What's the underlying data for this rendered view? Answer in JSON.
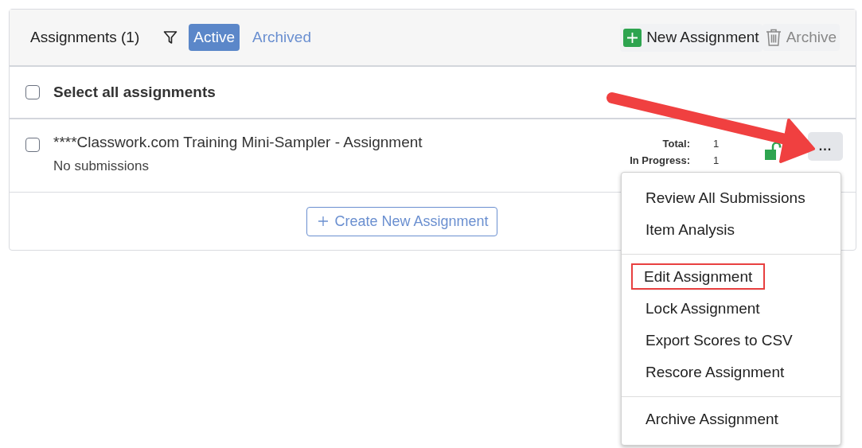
{
  "header": {
    "title": "Assignments (1)",
    "tabs": [
      {
        "label": "Active",
        "selected": true
      },
      {
        "label": "Archived",
        "selected": false
      }
    ],
    "actions": [
      {
        "kind": "new",
        "label": "New Assignment"
      },
      {
        "kind": "archive",
        "label": "Archive"
      }
    ]
  },
  "select_all": {
    "label": "Select all assignments",
    "checked": false
  },
  "assignments": [
    {
      "title": "****Classwork.com Training Mini-Sampler - Assignment",
      "subtitle": "No submissions",
      "checked": false,
      "locked": false,
      "menu_button": "...",
      "stats": [
        {
          "label": "Total:",
          "value": "1"
        },
        {
          "label": "In Progress:",
          "value": "1"
        }
      ]
    }
  ],
  "create_button": {
    "label": "Create New Assignment"
  },
  "menu": {
    "groups": [
      [
        {
          "label": "Review All Submissions",
          "highlighted": false
        },
        {
          "label": "Item Analysis",
          "highlighted": false
        }
      ],
      [
        {
          "label": "Edit Assignment",
          "highlighted": true
        },
        {
          "label": "Lock Assignment",
          "highlighted": false
        },
        {
          "label": "Export Scores to CSV",
          "highlighted": false
        },
        {
          "label": "Rescore Assignment",
          "highlighted": false
        }
      ],
      [
        {
          "label": "Archive Assignment",
          "highlighted": false
        }
      ]
    ]
  },
  "annotation": {
    "kind": "arrow"
  }
}
